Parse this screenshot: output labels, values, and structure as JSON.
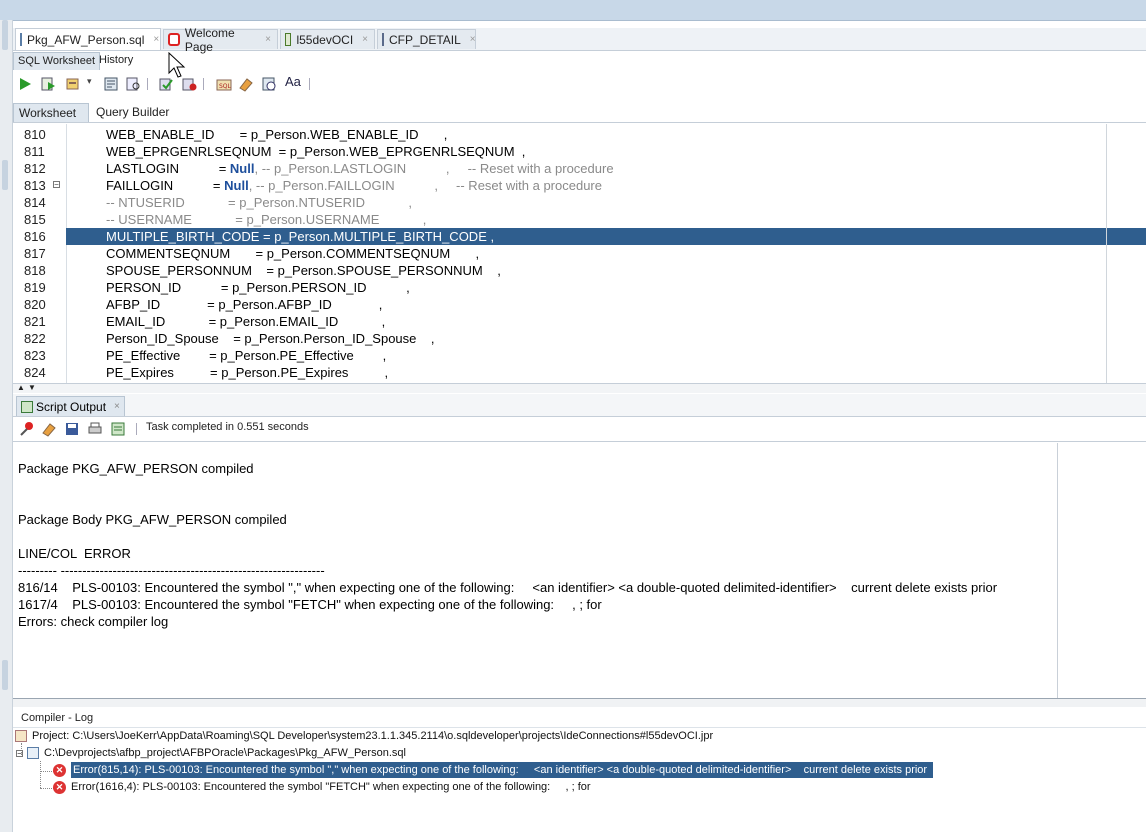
{
  "tabs": [
    {
      "label": "Pkg_AFW_Person.sql",
      "icon": "sql-file-icon",
      "close": "×"
    },
    {
      "label": "Welcome Page",
      "icon": "oracle-icon",
      "close": "×"
    },
    {
      "label": "l55devOCI",
      "icon": "connection-icon",
      "close": "×"
    },
    {
      "label": "CFP_DETAIL",
      "icon": "table-icon",
      "close": "×"
    }
  ],
  "subtabs": [
    "SQL Worksheet",
    "History"
  ],
  "worksheet_tabs": [
    "Worksheet",
    "Query Builder"
  ],
  "editor": {
    "lines": [
      {
        "num": "810",
        "text": "WEB_ENABLE_ID       = p_Person.WEB_ENABLE_ID       ,"
      },
      {
        "num": "811",
        "text": "WEB_EPRGENRLSEQNUM  = p_Person.WEB_EPRGENRLSEQNUM  ,"
      },
      {
        "num": "812",
        "pre": "LASTLOGIN           = ",
        "kw": "Null",
        "cm": ", -- p_Person.LASTLOGIN           ,     -- Reset with a procedure"
      },
      {
        "num": "813",
        "pre": "FAILLOGIN           = ",
        "kw": "Null",
        "cm": ", -- p_Person.FAILLOGIN           ,     -- Reset with a procedure"
      },
      {
        "num": "814",
        "cm_only": "-- NTUSERID            = p_Person.NTUSERID            ,"
      },
      {
        "num": "815",
        "cm_only": "-- USERNAME            = p_Person.USERNAME            ,"
      },
      {
        "num": "816",
        "text": "MULTIPLE_BIRTH_CODE = p_Person.MULTIPLE_BIRTH_CODE ,"
      },
      {
        "num": "817",
        "text": "COMMENTSEQNUM       = p_Person.COMMENTSEQNUM       ,"
      },
      {
        "num": "818",
        "text": "SPOUSE_PERSONNUM    = p_Person.SPOUSE_PERSONNUM    ,"
      },
      {
        "num": "819",
        "text": "PERSON_ID           = p_Person.PERSON_ID           ,"
      },
      {
        "num": "820",
        "text": "AFBP_ID             = p_Person.AFBP_ID             ,"
      },
      {
        "num": "821",
        "text": "EMAIL_ID            = p_Person.EMAIL_ID            ,"
      },
      {
        "num": "822",
        "text": "Person_ID_Spouse    = p_Person.Person_ID_Spouse    ,"
      },
      {
        "num": "823",
        "text": "PE_Effective        = p_Person.PE_Effective        ,"
      },
      {
        "num": "824",
        "text": "PE_Expires          = p_Person.PE_Expires          ,"
      }
    ]
  },
  "script_output": {
    "tab_label": "Script Output",
    "close": "×",
    "status": "Task completed in 0.551 seconds",
    "lines": [
      "Package PKG_AFW_PERSON compiled",
      "",
      "",
      "Package Body PKG_AFW_PERSON compiled",
      "",
      "LINE/COL  ERROR",
      "--------- -------------------------------------------------------------",
      "816/14    PLS-00103: Encountered the symbol \",\" when expecting one of the following:     <an identifier> <a double-quoted delimited-identifier>    current delete exists prior",
      "1617/4    PLS-00103: Encountered the symbol \"FETCH\" when expecting one of the following:     , ; for",
      "Errors: check compiler log"
    ]
  },
  "compiler_log": {
    "title": "Compiler - Log",
    "project": "Project: C:\\Users\\JoeKerr\\AppData\\Roaming\\SQL Developer\\system23.1.1.345.2114\\o.sqldeveloper\\projects\\IdeConnections#l55devOCI.jpr",
    "file": "C:\\Devprojects\\afbp_project\\AFBPOracle\\Packages\\Pkg_AFW_Person.sql",
    "errors": [
      "Error(815,14): PLS-00103: Encountered the symbol \",\" when expecting one of the following:     <an identifier> <a double-quoted delimited-identifier>    current delete exists prior",
      "Error(1616,4): PLS-00103: Encountered the symbol \"FETCH\" when expecting one of the following:     , ; for"
    ]
  },
  "colors": {
    "selection": "#2f5e8e",
    "keyword": "#1e4f9c",
    "comment": "#8a8a8a",
    "error": "#dd3333"
  }
}
